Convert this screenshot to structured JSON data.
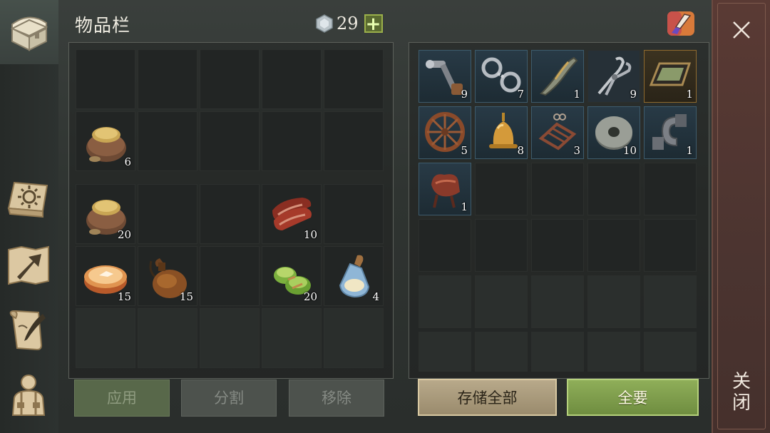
{
  "header": {
    "title": "物品栏",
    "currency_value": "29",
    "add_label": "+"
  },
  "sidebar": {
    "items": [
      {
        "icon": "chest-icon"
      },
      {
        "icon": "sun-book-icon"
      },
      {
        "icon": "map-arrow-icon"
      },
      {
        "icon": "quill-scroll-icon"
      },
      {
        "icon": "character-icon"
      }
    ]
  },
  "inventory": {
    "items": [
      {
        "name": "grain-sack-icon",
        "count": "6"
      },
      {
        "name": "grain-sack-icon",
        "count": "20"
      },
      {
        "name": "raw-meat-icon",
        "count": "10"
      },
      {
        "name": "pie-icon",
        "count": "15"
      },
      {
        "name": "waterskin-icon",
        "count": "15"
      },
      {
        "name": "green-stew-icon",
        "count": "20"
      },
      {
        "name": "potion-bottle-icon",
        "count": "4"
      }
    ],
    "buttons": {
      "apply": "应用",
      "split": "分割",
      "remove": "移除"
    }
  },
  "storage": {
    "items": [
      {
        "name": "crank-handle-icon",
        "count": "9"
      },
      {
        "name": "shackles-icon",
        "count": "7"
      },
      {
        "name": "ornate-blade-icon",
        "count": "1"
      },
      {
        "name": "tongs-icon",
        "count": "9"
      },
      {
        "name": "mirror-frame-icon",
        "count": "1"
      },
      {
        "name": "wagon-wheel-icon",
        "count": "5"
      },
      {
        "name": "bell-icon",
        "count": "8"
      },
      {
        "name": "rack-frame-icon",
        "count": "3"
      },
      {
        "name": "millstone-icon",
        "count": "10"
      },
      {
        "name": "metal-hook-icon",
        "count": "1"
      },
      {
        "name": "saddle-icon",
        "count": "1"
      }
    ],
    "buttons": {
      "store_all": "存储全部",
      "take_all": "全要"
    }
  },
  "close": {
    "label": "关闭"
  }
}
